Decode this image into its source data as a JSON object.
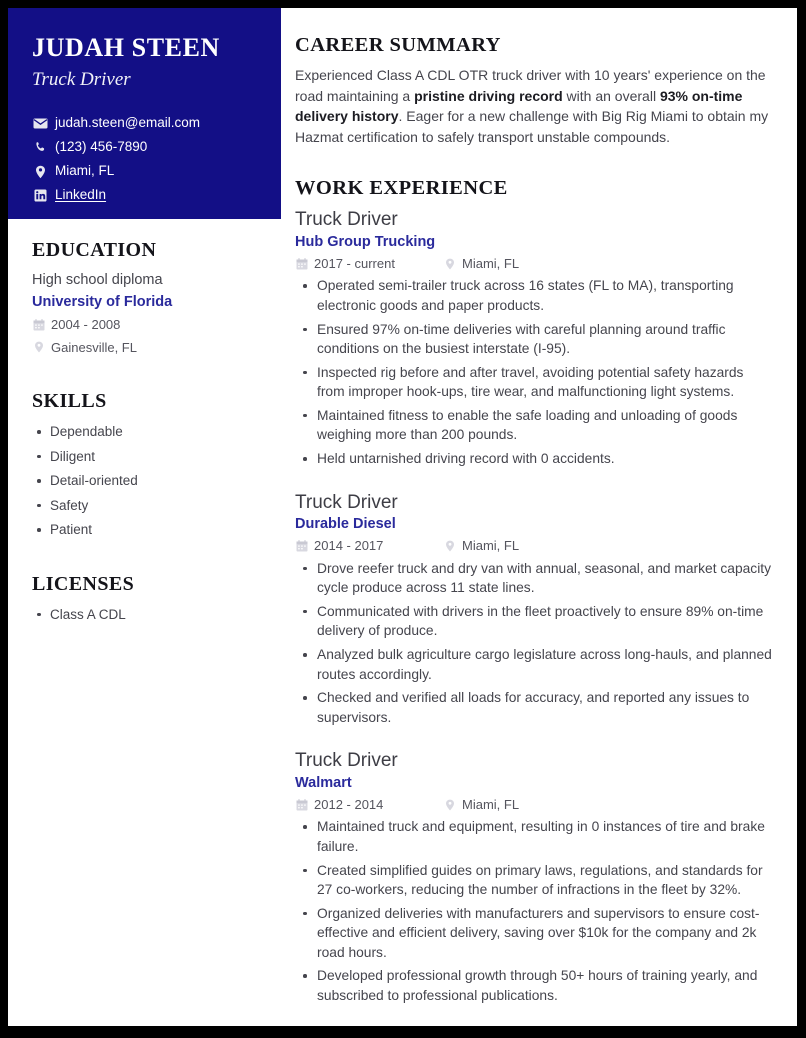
{
  "header": {
    "name": "JUDAH STEEN",
    "subtitle": "Truck Driver",
    "contacts": [
      {
        "icon": "envelope-icon",
        "text": "judah.steen@email.com",
        "link": false
      },
      {
        "icon": "phone-icon",
        "text": "(123) 456-7890",
        "link": false
      },
      {
        "icon": "location-pin-icon",
        "text": "Miami, FL",
        "link": false
      },
      {
        "icon": "linkedin-icon",
        "text": "LinkedIn",
        "link": true
      }
    ]
  },
  "education": {
    "title": "EDUCATION",
    "degree": "High school diploma",
    "school": "University of Florida",
    "dates": "2004 - 2008",
    "location": "Gainesville, FL"
  },
  "skills": {
    "title": "SKILLS",
    "items": [
      "Dependable",
      "Diligent",
      "Detail-oriented",
      "Safety",
      "Patient"
    ]
  },
  "licenses": {
    "title": "LICENSES",
    "items": [
      "Class A CDL"
    ]
  },
  "summary": {
    "title": "CAREER SUMMARY",
    "part1": "Experienced Class A CDL OTR truck driver with 10 years' experience on the road maintaining a ",
    "bold1": "pristine driving record",
    "part2": " with an overall ",
    "bold2": "93% on-time delivery history",
    "part3": ". Eager for a new challenge with Big Rig Miami to obtain my Hazmat certification to safely transport unstable compounds."
  },
  "work": {
    "title": "WORK EXPERIENCE",
    "jobs": [
      {
        "title": "Truck Driver",
        "company": "Hub Group Trucking",
        "dates": "2017 - current",
        "location": "Miami, FL",
        "bullets": [
          "Operated semi-trailer truck across 16 states (FL to MA), transporting electronic goods and paper products.",
          "Ensured 97% on-time deliveries with careful planning around traffic conditions on the busiest interstate (I-95).",
          "Inspected rig before and after travel, avoiding potential safety hazards from improper hook-ups, tire wear, and malfunctioning light systems.",
          "Maintained fitness to enable the safe loading and unloading of goods weighing more than 200 pounds.",
          "Held untarnished driving record with 0 accidents."
        ]
      },
      {
        "title": "Truck Driver",
        "company": "Durable Diesel",
        "dates": "2014 - 2017",
        "location": "Miami, FL",
        "bullets": [
          "Drove reefer truck and dry van with annual, seasonal, and market capacity cycle produce across 11 state lines.",
          "Communicated with drivers in the fleet proactively to ensure 89% on-time delivery of produce.",
          "Analyzed bulk agriculture cargo legislature across long-hauls, and planned routes accordingly.",
          "Checked and verified all loads for accuracy, and reported any issues to supervisors."
        ]
      },
      {
        "title": "Truck Driver",
        "company": "Walmart",
        "dates": "2012 - 2014",
        "location": "Miami, FL",
        "bullets": [
          "Maintained truck and equipment, resulting in 0 instances of tire and brake failure.",
          "Created simplified guides on primary laws, regulations, and standards for 27 co-workers, reducing the number of infractions in the fleet by 32%.",
          "Organized deliveries with manufacturers and supervisors to ensure cost-effective and efficient delivery, saving over $10k for the company and 2k road hours.",
          "Developed professional growth through 50+ hours of training yearly, and subscribed to professional publications."
        ]
      }
    ]
  },
  "colors": {
    "navy": "#130f86",
    "accent": "#2a2a9c",
    "body_text": "#45454d",
    "border": "#000000"
  }
}
